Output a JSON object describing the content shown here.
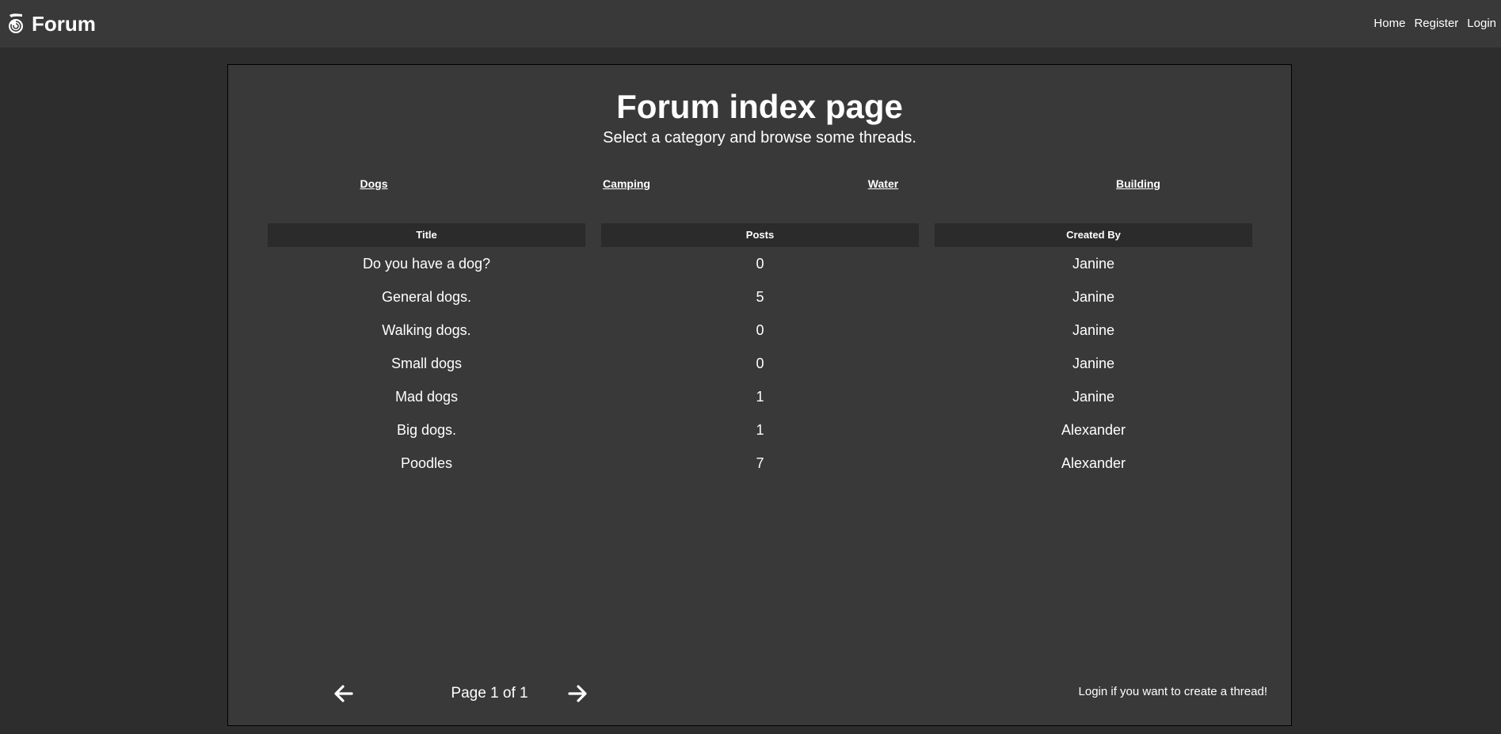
{
  "app": {
    "brand": "Forum",
    "nav": {
      "home": "Home",
      "register": "Register",
      "login": "Login"
    }
  },
  "main": {
    "title": "Forum index page",
    "subtitle": "Select a category and browse some threads.",
    "categories": [
      "Dogs",
      "Camping",
      "Water",
      "Building"
    ],
    "table": {
      "headers": [
        "Title",
        "Posts",
        "Created By"
      ],
      "rows": [
        {
          "title": "Do you have a dog?",
          "posts": "0",
          "created_by": "Janine"
        },
        {
          "title": "General dogs.",
          "posts": "5",
          "created_by": "Janine"
        },
        {
          "title": "Walking dogs.",
          "posts": "0",
          "created_by": "Janine"
        },
        {
          "title": "Small dogs",
          "posts": "0",
          "created_by": "Janine"
        },
        {
          "title": "Mad dogs",
          "posts": "1",
          "created_by": "Janine"
        },
        {
          "title": "Big dogs.",
          "posts": "1",
          "created_by": "Alexander"
        },
        {
          "title": "Poodles",
          "posts": "7",
          "created_by": "Alexander"
        }
      ]
    },
    "pagination": {
      "label": "Page 1 of 1",
      "prev_icon": "arrow-left-icon",
      "next_icon": "arrow-right-icon"
    },
    "login_prompt": "Login if you want to create a thread!"
  },
  "colors": {
    "page_background": "#2d2d2d",
    "panel_background": "#393939",
    "header_cell_background": "#2b2b2b",
    "text": "#ffffff"
  }
}
